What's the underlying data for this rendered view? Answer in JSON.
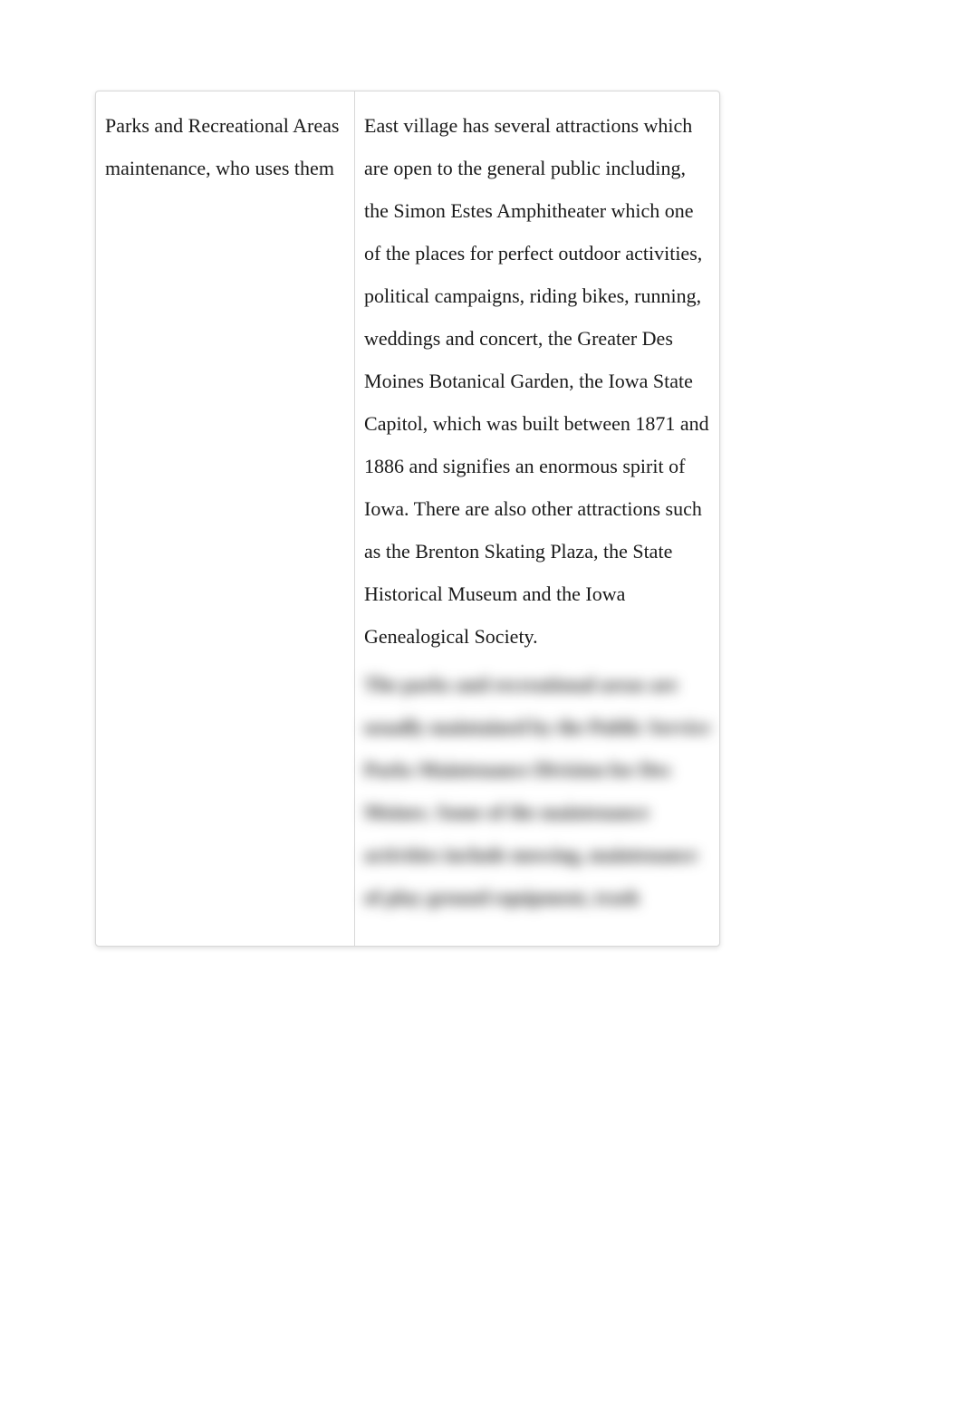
{
  "table": {
    "left": {
      "heading": "Parks and Recreational Areas maintenance, who uses them"
    },
    "right": {
      "paragraph": "East village has several attractions which are open to the general public including, the Simon Estes Amphitheater which one of the places for perfect outdoor activities, political campaigns, riding bikes, running, weddings and concert, the Greater Des Moines Botanical Garden, the Iowa State Capitol, which was built between 1871 and 1886 and signifies an enormous spirit of Iowa. There are also other attractions such as the Brenton Skating Plaza, the State Historical Museum and the Iowa Genealogical Society.",
      "blurred_lines": [
        "The parks and recreational areas are",
        "usually maintained by the Public Service",
        "Parks Maintenance Division for Des",
        "Moines. Some of the maintenance",
        "activities include mowing, maintenance",
        "of play ground equipment, trash"
      ]
    }
  }
}
